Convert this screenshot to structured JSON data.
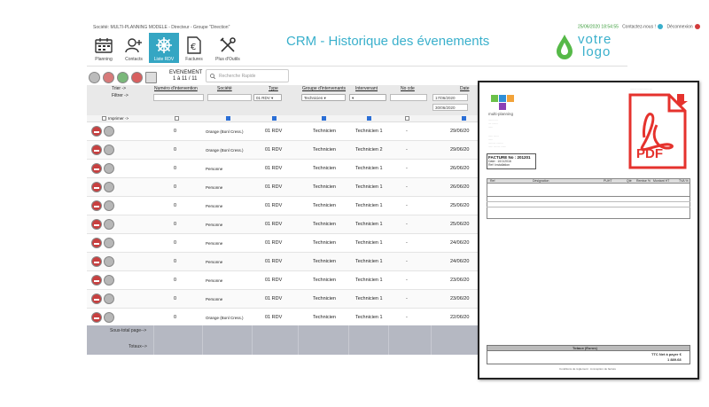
{
  "topbar": {
    "society": "Société: MULTI-PLANNING MODELE -",
    "group": "Directeur - Groupe \"Direction\"",
    "date": "25/06/2020 18:54:55",
    "contact": "Contactez-nous !",
    "logout": "Déconnexion"
  },
  "nav": {
    "items": [
      {
        "label": "Planning",
        "icon": "calendar-icon"
      },
      {
        "label": "Contacts",
        "icon": "contacts-icon"
      },
      {
        "label": "Liste RDV",
        "icon": "helm-icon"
      },
      {
        "label": "Factures",
        "icon": "euro-invoice-icon"
      },
      {
        "label": "Plus d'Outils",
        "icon": "tools-icon"
      }
    ]
  },
  "page_title": "CRM - Historique des évenements",
  "brand": {
    "line1": "votre",
    "line2": "logo"
  },
  "events": {
    "label": "EVENEMENT",
    "count": "1 à 11 / 11"
  },
  "search": {
    "placeholder": "Recherche Rapide"
  },
  "grid": {
    "trier": "Trier ->",
    "filtrer": "Filtrer ->",
    "headers": [
      "Numéro d'intervention",
      "Société",
      "Type",
      "Groupe d'intervenants",
      "Intervenant",
      "No cde",
      "Date"
    ],
    "type_filter": "01 RDV",
    "group_filter": "Technicien",
    "date_from": "17/06/2020",
    "date_to": "30/06/2020",
    "imprimer": "Imprimer ->",
    "rows": [
      {
        "num": "0",
        "societe": "Orange (Bonl Cress.)",
        "type": "01 RDV",
        "groupe": "Technicien",
        "intervenant": "Technicien 1",
        "cde": "-",
        "date": "29/06/20"
      },
      {
        "num": "0",
        "societe": "Orange (Bonl Cress.)",
        "type": "01 RDV",
        "groupe": "Technicien",
        "intervenant": "Technicien 2",
        "cde": "-",
        "date": "29/06/20"
      },
      {
        "num": "0",
        "societe": "Personne",
        "type": "01 RDV",
        "groupe": "Technicien",
        "intervenant": "Technicien 1",
        "cde": "-",
        "date": "26/06/20"
      },
      {
        "num": "0",
        "societe": "Personne",
        "type": "01 RDV",
        "groupe": "Technicien",
        "intervenant": "Technicien 1",
        "cde": "-",
        "date": "26/06/20"
      },
      {
        "num": "0",
        "societe": "Personne",
        "type": "01 RDV",
        "groupe": "Technicien",
        "intervenant": "Technicien 1",
        "cde": "-",
        "date": "25/06/20"
      },
      {
        "num": "0",
        "societe": "Personne",
        "type": "01 RDV",
        "groupe": "Technicien",
        "intervenant": "Technicien 1",
        "cde": "-",
        "date": "25/06/20"
      },
      {
        "num": "0",
        "societe": "Personne",
        "type": "01 RDV",
        "groupe": "Technicien",
        "intervenant": "Technicien 1",
        "cde": "-",
        "date": "24/06/20"
      },
      {
        "num": "0",
        "societe": "Personne",
        "type": "01 RDV",
        "groupe": "Technicien",
        "intervenant": "Technicien 1",
        "cde": "-",
        "date": "24/06/20"
      },
      {
        "num": "0",
        "societe": "Personne",
        "type": "01 RDV",
        "groupe": "Technicien",
        "intervenant": "Technicien 1",
        "cde": "-",
        "date": "23/06/20"
      },
      {
        "num": "0",
        "societe": "Personne",
        "type": "01 RDV",
        "groupe": "Technicien",
        "intervenant": "Technicien 1",
        "cde": "-",
        "date": "23/06/20"
      },
      {
        "num": "0",
        "societe": "Orange (Bonl Cress.)",
        "type": "01 RDV",
        "groupe": "Technicien",
        "intervenant": "Technicien 1",
        "cde": "-",
        "date": "22/06/20"
      }
    ],
    "subtotal": "Sous-total page-->",
    "totaux": "Totaux-->"
  },
  "invoice": {
    "brand": "multi-planning",
    "facture": "FACTURE No : 201201",
    "date": "Date : 10/1/2016",
    "ref": "Ref: Installation",
    "cols": [
      "Ref",
      "Désignation",
      "PUHT",
      "Qté",
      "Remise %",
      "Montant HT",
      "TVA %"
    ],
    "totaux_title": "Totaux (Euros)",
    "ttc": "TTC Net à payer €",
    "ttc_value": "1 889.68",
    "footer": "Conditions de règlement : A réception de facture",
    "pdf": "PDF"
  },
  "colors": {
    "accent": "#35a6c3",
    "pdf_red": "#e5322d",
    "totals_band": "#b5b8c2"
  }
}
